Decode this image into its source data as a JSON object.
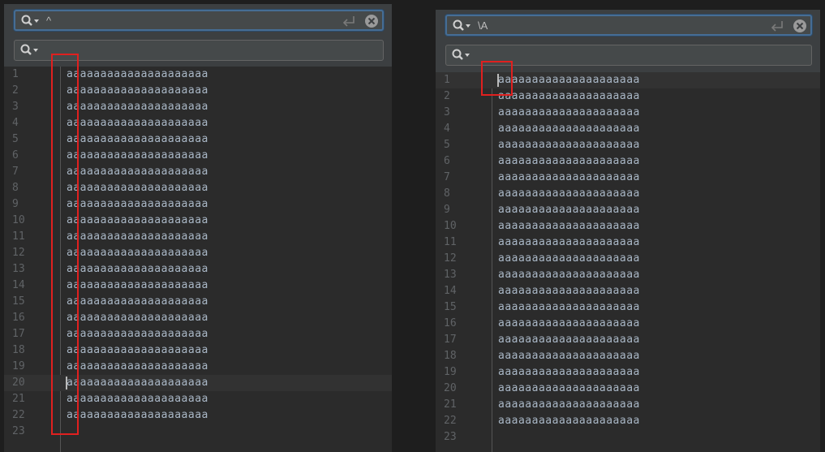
{
  "left_panel": {
    "search_query": "^",
    "replace_query": "",
    "line_numbers": [
      "1",
      "2",
      "3",
      "4",
      "5",
      "6",
      "7",
      "8",
      "9",
      "10",
      "11",
      "12",
      "13",
      "14",
      "15",
      "16",
      "17",
      "18",
      "19",
      "20",
      "21",
      "22",
      "23"
    ],
    "line_text": "aaaaaaaaaaaaaaaaaaaaa",
    "text_line_count": 22,
    "current_line": 20
  },
  "right_panel": {
    "search_query": "\\A",
    "replace_query": "",
    "line_numbers": [
      "1",
      "2",
      "3",
      "4",
      "5",
      "6",
      "7",
      "8",
      "9",
      "10",
      "11",
      "12",
      "13",
      "14",
      "15",
      "16",
      "17",
      "18",
      "19",
      "20",
      "21",
      "22",
      "23"
    ],
    "line_text": "aaaaaaaaaaaaaaaaaaaaa",
    "text_line_count": 22,
    "current_line": 1
  },
  "colors": {
    "background": "#2b2b2b",
    "text": "#a9b7c6",
    "line_number": "#606366",
    "focus_border": "#466d94",
    "highlight_box": "#e0201f"
  },
  "icons": {
    "search": "search-options-icon",
    "enter": "enter-return-icon",
    "clear": "clear-circle-icon"
  }
}
